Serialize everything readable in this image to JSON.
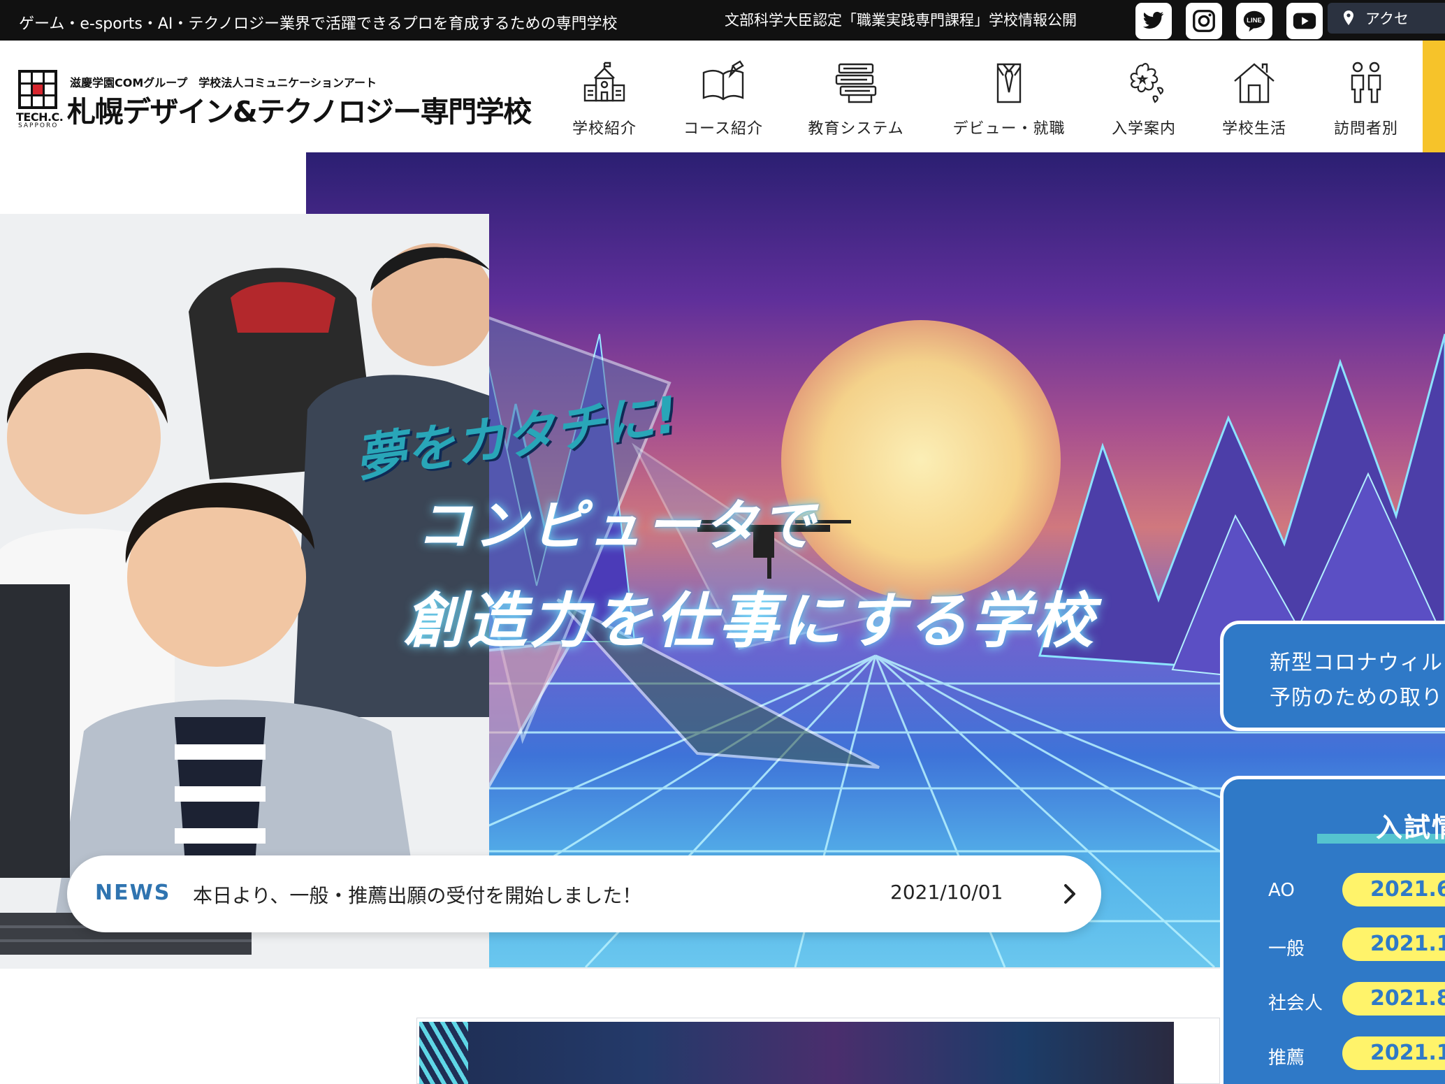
{
  "topbar": {
    "tagline": "ゲーム・e-sports・AI・テクノロジー業界で活躍できるプロを育成するための専門学校",
    "certified_link": "文部科学大臣認定「職業実践専門課程」学校情報公開",
    "social": [
      {
        "name": "twitter-icon"
      },
      {
        "name": "instagram-icon"
      },
      {
        "name": "line-icon",
        "label": "LINE"
      },
      {
        "name": "youtube-icon"
      }
    ],
    "access_label": "アクセ"
  },
  "logo": {
    "tech": "TECH.C.",
    "sapporo": "SAPPORO",
    "group": "滋慶学園COMグループ　学校法人コミュニケーションアート",
    "name": "札幌デザイン&テクノロジー専門学校"
  },
  "nav": [
    {
      "label": "学校紹介",
      "icon": "school-building-icon"
    },
    {
      "label": "コース紹介",
      "icon": "open-book-icon"
    },
    {
      "label": "教育システム",
      "icon": "stacked-books-icon"
    },
    {
      "label": "デビュー・就職",
      "icon": "shirt-tie-icon"
    },
    {
      "label": "入学案内",
      "icon": "sakura-icon"
    },
    {
      "label": "学校生活",
      "icon": "house-icon"
    },
    {
      "label": "訪問者別",
      "icon": "people-icon"
    }
  ],
  "hero": {
    "slogan_small": "夢をカタチに!",
    "slogan_line1": "コンピュータで",
    "slogan_line2": "創造力を仕事にする学校"
  },
  "news": {
    "label": "NEWS",
    "text": "本日より、一般・推薦出願の受付を開始しました！",
    "date": "2021/10/01"
  },
  "corona": {
    "line1": "新型コロナウィル",
    "line2": "予防のための取り"
  },
  "exam": {
    "title": "入試情",
    "rows": [
      {
        "name": "AO",
        "date": "2021.6"
      },
      {
        "name": "一般",
        "date": "2021.1"
      },
      {
        "name": "社会人",
        "date": "2021.8"
      },
      {
        "name": "推薦",
        "date": "2021.1"
      }
    ]
  },
  "colors": {
    "topbar": "#111111",
    "accent_blue": "#2f79c7",
    "news_blue": "#2f74b0",
    "yellow": "#fff36a",
    "nav_tab_yellow": "#f6c32a"
  }
}
